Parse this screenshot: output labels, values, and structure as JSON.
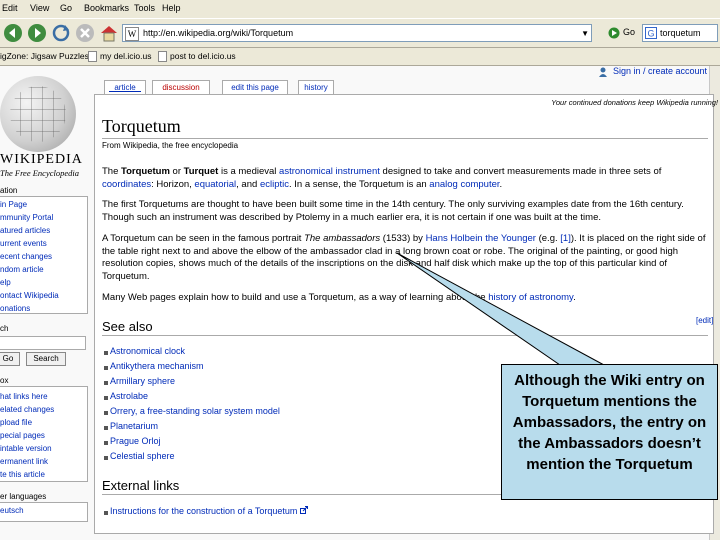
{
  "menu": [
    "Edit",
    "View",
    "Go",
    "Bookmarks",
    "Tools",
    "Help"
  ],
  "address": {
    "url": "http://en.wikipedia.org/wiki/Torquetum",
    "go_label": "Go",
    "search_value": "torquetum"
  },
  "bookmarks": [
    "igZone: Jigsaw Puzzles",
    "my del.icio.us",
    "post to del.icio.us"
  ],
  "logo": {
    "name": "WIKIPEDIA",
    "tagline": "The Free Encyclopedia"
  },
  "sidebar": {
    "nav_head": "ation",
    "nav_items": [
      "in Page",
      "mmunity Portal",
      "atured articles",
      "urrent events",
      "ecent changes",
      "ndom article",
      "elp",
      "ontact Wikipedia",
      "onations"
    ],
    "search_head": "ch",
    "go_button": "Go",
    "search_button": "Search",
    "toolbox_head": "ox",
    "toolbox_items": [
      "hat links here",
      "elated changes",
      "pload file",
      "pecial pages",
      "intable version",
      "ermanent link",
      "te this article"
    ],
    "lang_head": "er languages",
    "lang_items": [
      "eutsch"
    ]
  },
  "tabs": [
    "article",
    "discussion",
    "edit this page",
    "history"
  ],
  "signin": "Sign in / create account",
  "donation": "Your continued donations keep Wikipedia running!",
  "article": {
    "title": "Torquetum",
    "from": "From Wikipedia, the free encyclopedia",
    "p1_parts": [
      "The ",
      "Torquetum",
      " or ",
      "Turquet",
      " is a medieval ",
      "astronomical instrument",
      " designed to take and convert measurements made in three sets of ",
      "coordinates",
      ": Horizon, ",
      "equatorial",
      ", and ",
      "ecliptic",
      ". In a sense, the Torquetum is an ",
      "analog computer",
      "."
    ],
    "p2": "The first Torquetums are thought to have been built some time in the 14th century. The only surviving examples date from the 16th century. Though such an instrument was described by Ptolemy in a much earlier era, it is not certain if one was built at the time.",
    "p3_parts": [
      "A Torquetum can be seen in the famous portrait ",
      "The ambassadors",
      " (1533) by ",
      "Hans Holbein the Younger",
      " (e.g. ",
      "[1]",
      "). It is placed on the right side of the table right next to and above the elbow of the ambassador clad in a long brown coat or robe. The original of the painting, or good high resolution copies, shows much of the details of the inscriptions on the disk and half disk which make up the top of this particular kind of Torquetum."
    ],
    "p4_parts": [
      "Many Web pages explain how to build and use a Torquetum, as a way of learning about the ",
      "history of astronomy",
      "."
    ],
    "see_also_heading": "See also",
    "edit_label": "[edit]",
    "see_also": [
      "Astronomical clock",
      "Antikythera mechanism",
      "Armillary sphere",
      "Astrolabe",
      "Orrery, a free-standing solar system model",
      "Planetarium",
      "Prague Orloj",
      "Celestial sphere"
    ],
    "external_heading": "External links",
    "external_links": [
      "Instructions for the construction of a Torquetum"
    ]
  },
  "callout": "Although the Wiki entry on Torquetum mentions the Ambassadors, the entry on the Ambassadors doesn’t mention the Torquetum",
  "colors": {
    "link": "#002bb8",
    "redlink": "#ba0000",
    "callout_fill": "#b8dcec",
    "chrome": "#ece9d8"
  },
  "icons": [
    "back-icon",
    "forward-icon",
    "reload-icon",
    "stop-icon",
    "home-icon",
    "go-icon",
    "google-search-icon",
    "user-icon",
    "external-link-icon"
  ]
}
